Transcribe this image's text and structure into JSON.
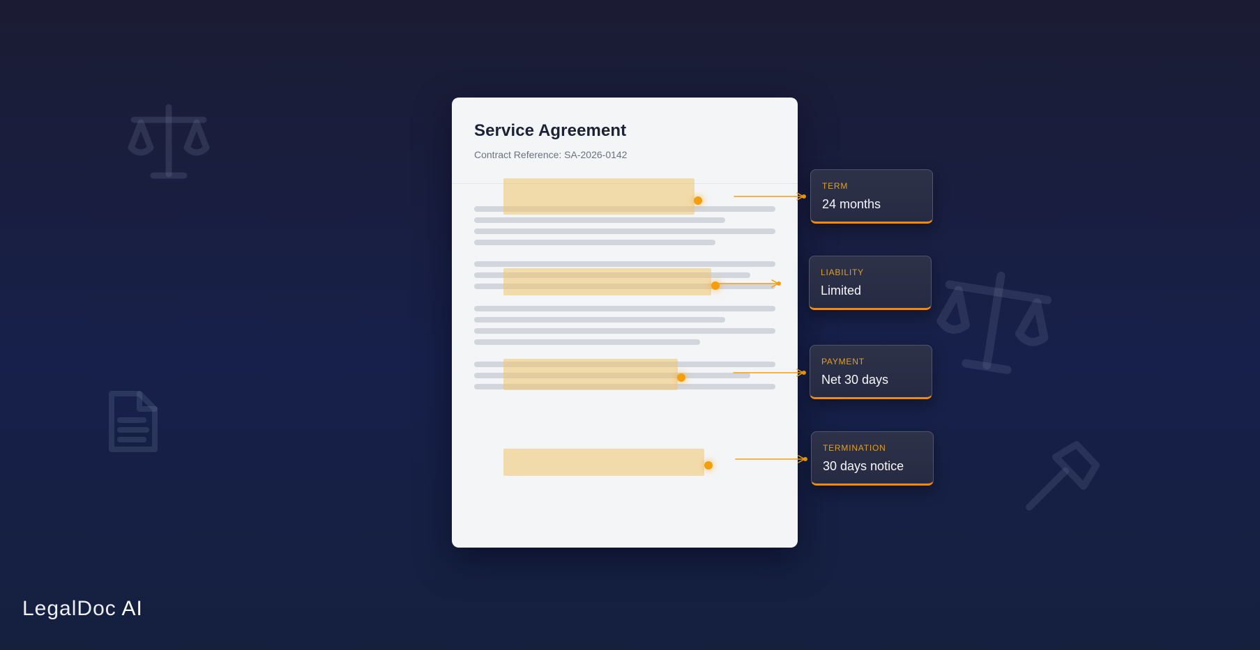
{
  "document": {
    "title": "Service Agreement",
    "reference": "Contract Reference: SA-2026-0142"
  },
  "clauses": [
    {
      "label": "TERM",
      "value": "24 months"
    },
    {
      "label": "LIABILITY",
      "value": "Limited"
    },
    {
      "label": "PAYMENT",
      "value": "Net 30 days"
    },
    {
      "label": "TERMINATION",
      "value": "30 days notice"
    }
  ],
  "brand": {
    "name": "LegalDoc",
    "suffix": "AI"
  },
  "colors": {
    "accent": "#f59e0b",
    "card_border_accent": "#f08a12",
    "highlight": "#f0c46e",
    "background": "#17204a",
    "document_paper": "#f4f5f6"
  },
  "icons": {
    "background_left_top": "scales-icon",
    "background_left_bottom": "document-icon",
    "background_right_middle": "scales-icon",
    "background_right_bottom": "gavel-icon"
  }
}
